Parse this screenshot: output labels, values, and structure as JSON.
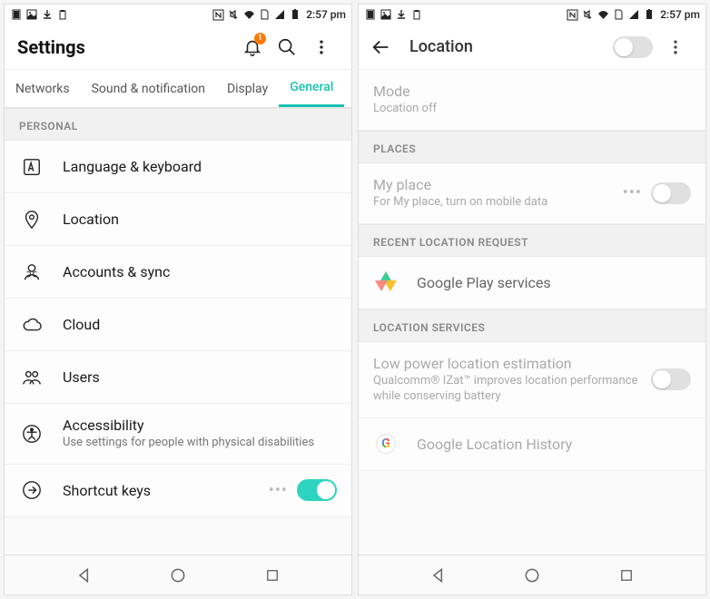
{
  "status": {
    "time": "2:57 pm"
  },
  "left": {
    "header": {
      "title": "Settings",
      "badge": "1"
    },
    "tabs": [
      "Networks",
      "Sound & notification",
      "Display",
      "General"
    ],
    "active_tab": 3,
    "section": "PERSONAL",
    "items": [
      {
        "icon": "language-icon",
        "title": "Language & keyboard"
      },
      {
        "icon": "location-pin-icon",
        "title": "Location"
      },
      {
        "icon": "accounts-icon",
        "title": "Accounts & sync"
      },
      {
        "icon": "cloud-icon",
        "title": "Cloud"
      },
      {
        "icon": "users-icon",
        "title": "Users"
      },
      {
        "icon": "accessibility-icon",
        "title": "Accessibility",
        "subtitle": "Use settings for people with physical disabilities"
      },
      {
        "icon": "shortcut-icon",
        "title": "Shortcut keys",
        "toggle": true,
        "dots": true
      }
    ]
  },
  "right": {
    "header": {
      "title": "Location"
    },
    "top": {
      "title": "Mode",
      "subtitle": "Location off"
    },
    "places_header": "PLACES",
    "places_item": {
      "title": "My place",
      "subtitle": "For My place, turn on mobile data",
      "dots": true,
      "toggle": false
    },
    "recent_header": "RECENT LOCATION REQUEST",
    "recent_item": {
      "title": "Google Play services"
    },
    "services_header": "LOCATION SERVICES",
    "services_items": [
      {
        "title": "Low power location estimation",
        "subtitle": "Qualcomm® IZat™ improves location performance while conserving battery",
        "toggle": false
      },
      {
        "title": "Google Location History",
        "gicon": true
      }
    ]
  }
}
